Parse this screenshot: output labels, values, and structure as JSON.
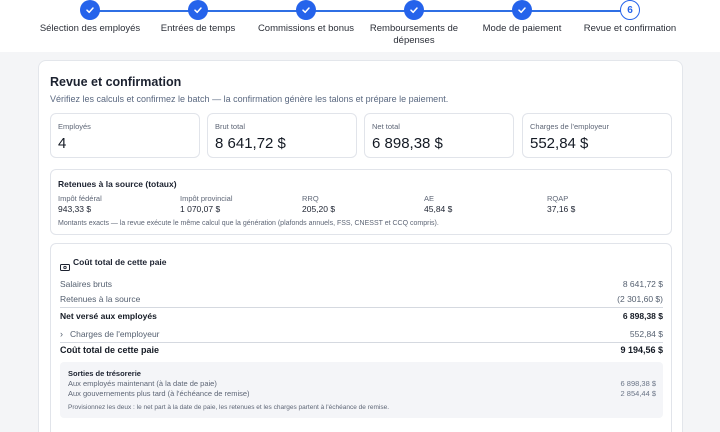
{
  "stepper": {
    "steps": [
      {
        "label": "Sélection des employés",
        "status": "done"
      },
      {
        "label": "Entrées de temps",
        "status": "done"
      },
      {
        "label": "Commissions et bonus",
        "status": "done"
      },
      {
        "label": "Remboursements de dépenses",
        "status": "done"
      },
      {
        "label": "Mode de paiement",
        "status": "done"
      },
      {
        "label": "Revue et confirmation",
        "status": "current",
        "number": "6"
      }
    ]
  },
  "review": {
    "title": "Revue et confirmation",
    "subtitle": "Vérifiez les calculs et confirmez le batch — la confirmation génère les talons et prépare le paiement.",
    "metrics": [
      {
        "label": "Employés",
        "value": "4"
      },
      {
        "label": "Brut total",
        "value": "8 641,72 $"
      },
      {
        "label": "Net total",
        "value": "6 898,38 $"
      },
      {
        "label": "Charges de l'employeur",
        "value": "552,84 $"
      }
    ]
  },
  "withholdings": {
    "title": "Retenues à la source (totaux)",
    "items": [
      {
        "label": "Impôt fédéral",
        "value": "943,33 $"
      },
      {
        "label": "Impôt provincial",
        "value": "1 070,07 $"
      },
      {
        "label": "RRQ",
        "value": "205,20 $"
      },
      {
        "label": "AE",
        "value": "45,84 $"
      },
      {
        "label": "RQAP",
        "value": "37,16 $"
      }
    ],
    "note": "Montants exacts — la revue exécute le même calcul que la génération (plafonds annuels, FSS, CNESST et CCQ compris)."
  },
  "cost": {
    "title": "Coût total de cette paie",
    "gross_label": "Salaires bruts",
    "gross_value": "8 641,72 $",
    "withheld_label": "Retenues à la source",
    "withheld_value": "(2 301,60 $)",
    "net_label": "Net versé aux employés",
    "net_value": "6 898,38 $",
    "employer_label": "Charges de l'employeur",
    "employer_value": "552,84 $",
    "total_label": "Coût total de cette paie",
    "total_value": "9 194,56 $",
    "treasury": {
      "title": "Sorties de trésorerie",
      "employees_label": "Aux employés maintenant (à la date de paie)",
      "employees_value": "6 898,38 $",
      "gov_label": "Aux gouvernements plus tard (à l'échéance de remise)",
      "gov_value": "2 854,44 $",
      "note": "Provisionnez les deux : le net part à la date de paie, les retenues et les charges partent à l'échéance de remise."
    }
  },
  "colors": {
    "accent": "#2563eb"
  }
}
